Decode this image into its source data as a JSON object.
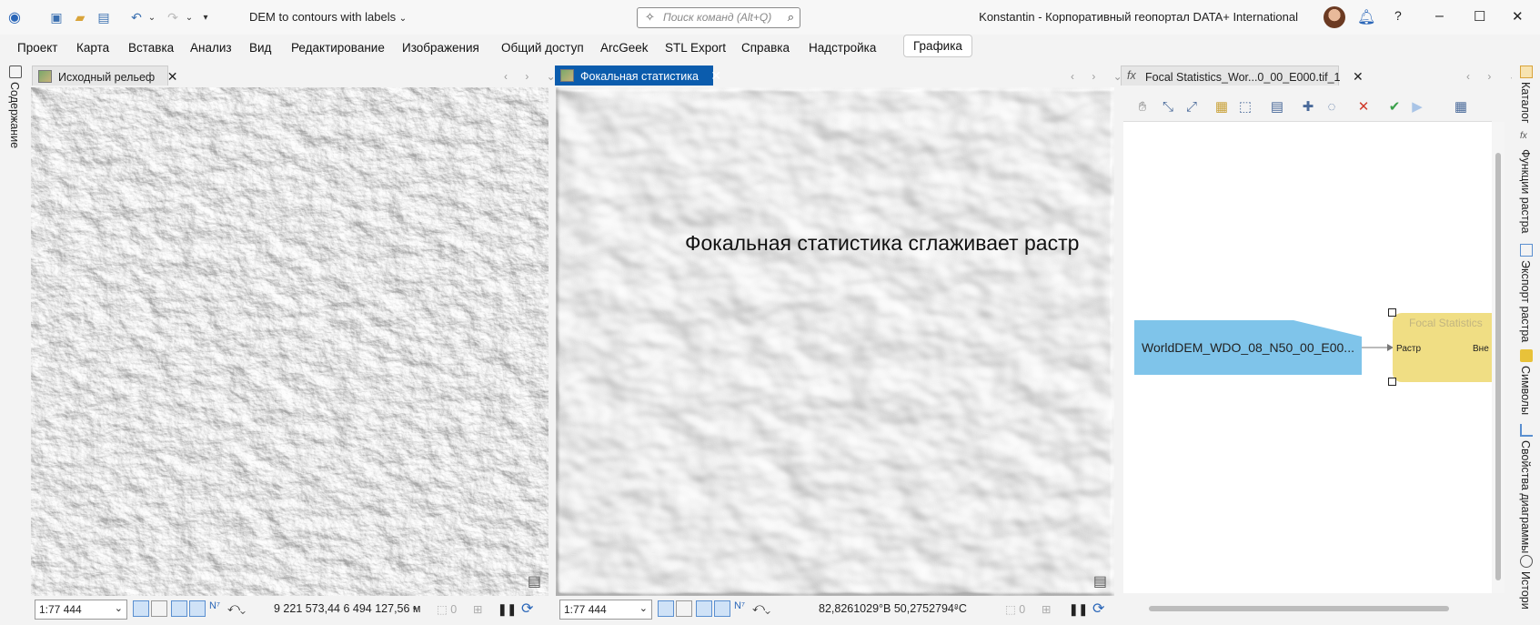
{
  "app": {
    "title": "DEM to contours with labels",
    "search_placeholder": "Поиск команд (Alt+Q)",
    "user_portal": "Konstantin - Корпоративный геопортал DATA+ International"
  },
  "menu": [
    "Проект",
    "Карта",
    "Вставка",
    "Анализ",
    "Вид",
    "Редактирование",
    "Изображения",
    "Общий доступ",
    "ArcGeek",
    "STL Export",
    "Справка",
    "Надстройка",
    "Графика"
  ],
  "left_panel": {
    "label": "Содержание"
  },
  "pane1": {
    "tab": "Исходный рельеф",
    "scale": "1:77 444",
    "coords": "9 221 573,44 6 494 127,56 м"
  },
  "pane2": {
    "tab": "Фокальная статистика",
    "scale": "1:77 444",
    "coords": "82,8261029°В 50,2752794°С",
    "annotation": "Фокальная статистика сглаживает растр"
  },
  "pane3": {
    "tab": "Focal Statistics_Wor...0_00_E000.tif_1",
    "tab_icon": "fx"
  },
  "model": {
    "input_node": "WorldDEM_WDO_08_N50_00_E00...",
    "tool_node": "Focal Statistics",
    "tool_param_in": "Растр",
    "tool_param_out": "Вне"
  },
  "status_counts": {
    "selected": "0",
    "selected2": "0"
  },
  "right_panels": [
    "Каталог",
    "Функции растра",
    "Экспорт растра",
    "Символы",
    "Свойства диаграммы",
    "Истори"
  ],
  "colors": {
    "accent": "#0b5cad",
    "model_input": "#7fc4ea",
    "model_tool": "#f0de84"
  },
  "icons": [
    "app-logo-icon",
    "new-project-icon",
    "open-project-icon",
    "save-project-icon",
    "undo-icon",
    "redo-icon",
    "search-icon",
    "notifications-icon",
    "help-icon",
    "minimize-icon",
    "maximize-icon",
    "close-icon",
    "pan-icon",
    "run-icon",
    "validate-icon",
    "delete-icon"
  ]
}
